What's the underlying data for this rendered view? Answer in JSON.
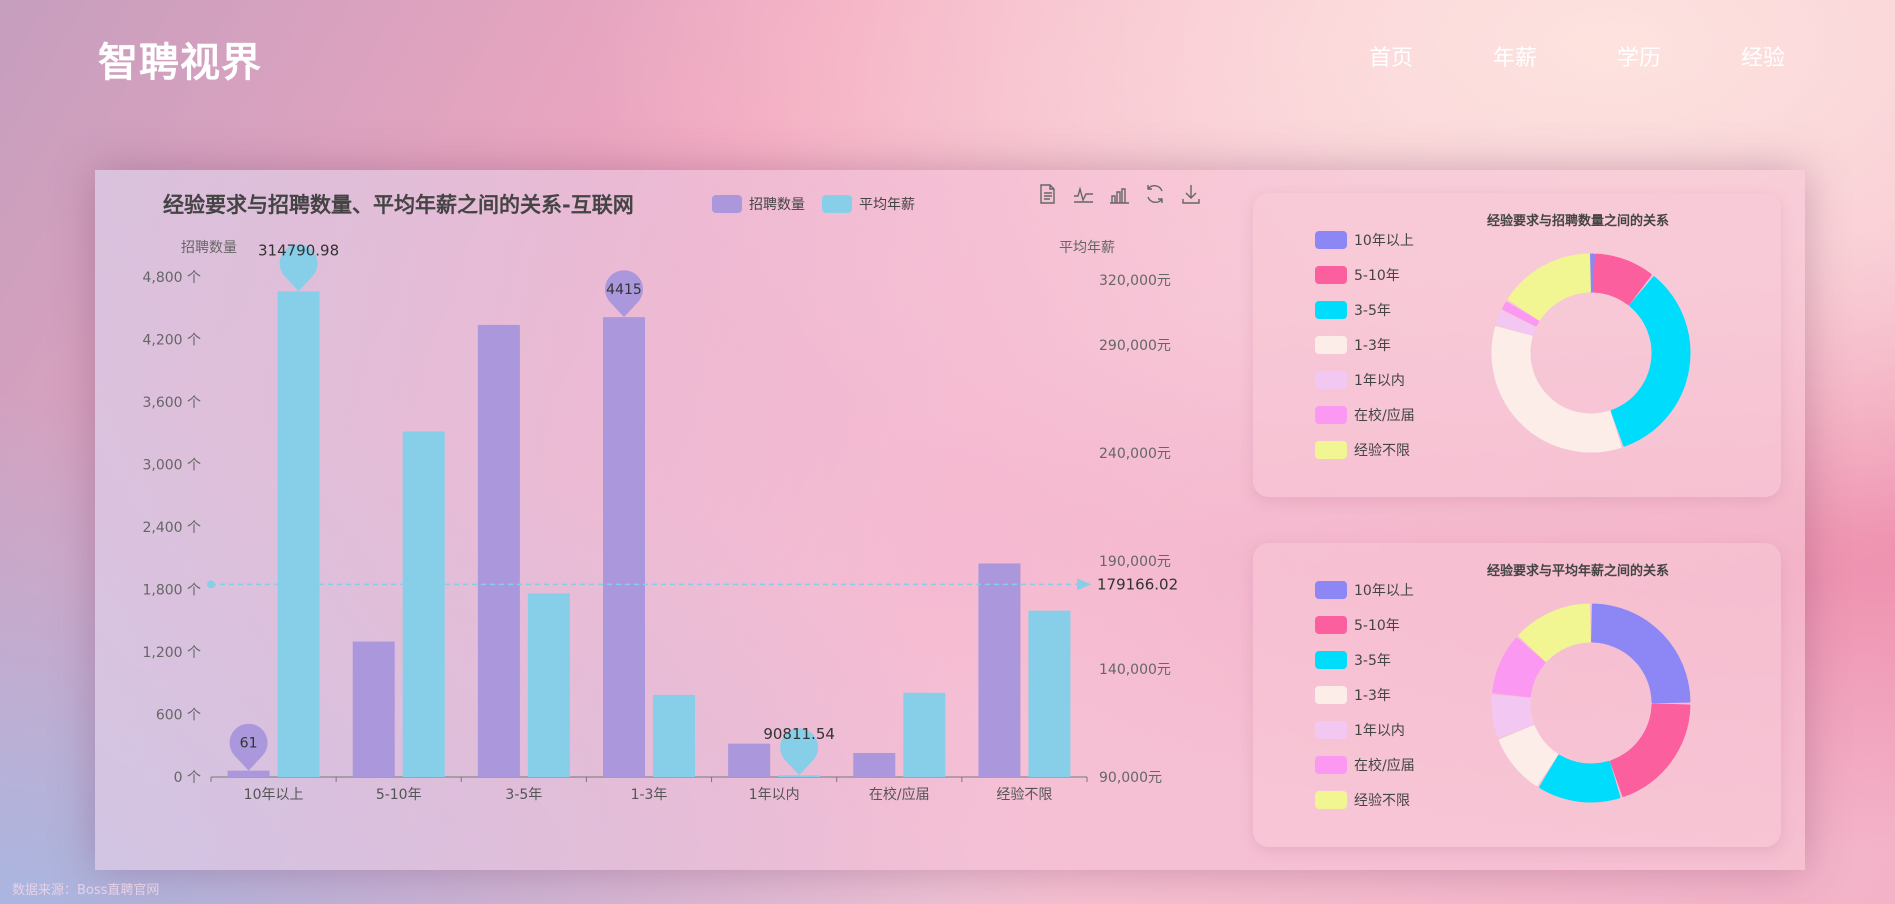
{
  "brand": "智聘视界",
  "nav": [
    "首页",
    "年薪",
    "学历",
    "经验"
  ],
  "source_note": "数据来源：Boss直聘官网",
  "colors": {
    "count_bar": "#ab97dc",
    "salary_bar": "#87cfe8",
    "pie": [
      "#8d86f5",
      "#fc5f9e",
      "#00dcfc",
      "#fcede9",
      "#f2c8f2",
      "#fb99f2",
      "#f1f592"
    ]
  },
  "toolbar_icons": [
    "data-view-icon",
    "line-chart-icon",
    "bar-chart-icon",
    "restore-icon",
    "download-icon"
  ],
  "chart_data": [
    {
      "type": "bar",
      "title": "经验要求与招聘数量、平均年薪之间的关系-互联网",
      "categories": [
        "10年以上",
        "5-10年",
        "3-5年",
        "1-3年",
        "1年以内",
        "在校/应届",
        "经验不限"
      ],
      "series": [
        {
          "name": "招聘数量",
          "axis": "left",
          "values": [
            61,
            1300,
            4340,
            4415,
            320,
            230,
            2050
          ]
        },
        {
          "name": "平均年薪",
          "axis": "right",
          "values": [
            314790.98,
            250000,
            175000,
            128000,
            90811.54,
            129000,
            167000
          ]
        }
      ],
      "y_left": {
        "label": "招聘数量",
        "min": 0,
        "max": 4800,
        "ticks": [
          "0 个",
          "600 个",
          "1,200 个",
          "1,800 个",
          "2,400 个",
          "3,000 个",
          "3,600 个",
          "4,200 个",
          "4,800 个"
        ]
      },
      "y_right": {
        "label": "平均年薪",
        "ticks": [
          "90,000元",
          "140,000元",
          "190,000元",
          "240,000元",
          "290,000元",
          "320,000元"
        ],
        "tick_values": [
          90000,
          140000,
          190000,
          240000,
          290000,
          320000
        ]
      },
      "mark_points": [
        {
          "series": "招聘数量",
          "category": "10年以上",
          "label": "61"
        },
        {
          "series": "招聘数量",
          "category": "1-3年",
          "label": "4415"
        },
        {
          "series": "平均年薪",
          "category": "10年以上",
          "label": "314790.98"
        },
        {
          "series": "平均年薪",
          "category": "1年以内",
          "label": "90811.54"
        }
      ],
      "mark_line": {
        "series": "平均年薪",
        "type": "average",
        "label": "179166.02",
        "value": 179166.02
      },
      "legend": "top-center"
    },
    {
      "type": "pie",
      "title": "经验要求与招聘数量之间的关系",
      "labels": [
        "10年以上",
        "5-10年",
        "3-5年",
        "1-3年",
        "1年以内",
        "在校/应届",
        "经验不限"
      ],
      "values": [
        61,
        1300,
        4340,
        4415,
        320,
        230,
        2050
      ]
    },
    {
      "type": "pie",
      "title": "经验要求与平均年薪之间的关系",
      "labels": [
        "10年以上",
        "5-10年",
        "3-5年",
        "1-3年",
        "1年以内",
        "在校/应届",
        "经验不限"
      ],
      "values": [
        314790.98,
        250000,
        175000,
        128000,
        90811.54,
        129000,
        167000
      ]
    }
  ]
}
